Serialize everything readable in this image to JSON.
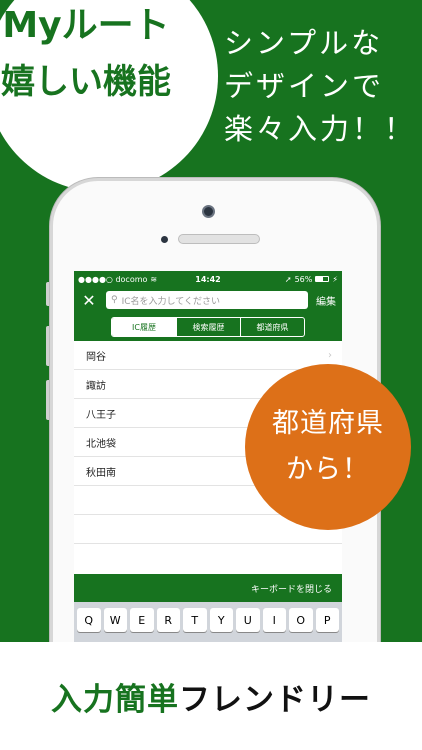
{
  "promo": {
    "circle": {
      "line1": "Myルート",
      "line2": "嬉しい機能"
    },
    "tagline": [
      "シンプルな",
      "デザインで",
      "楽々入力！！"
    ],
    "orange_badge": {
      "line1": "都道府県",
      "line2": "から！"
    },
    "footer": {
      "part1": "入力簡単",
      "part2": "フレンドリー"
    }
  },
  "statusbar": {
    "carrier": "●●●●○ docomo",
    "time": "14:42",
    "battery": "56%",
    "battery_level": 0.56
  },
  "navbar": {
    "search_placeholder": "IC名を入力してください",
    "edit_label": "編集"
  },
  "tabs": [
    {
      "label": "IC履歴"
    },
    {
      "label": "検索履歴"
    },
    {
      "label": "都道府県"
    }
  ],
  "list": {
    "items": [
      {
        "label": "岡谷"
      },
      {
        "label": "諏訪"
      },
      {
        "label": "八王子"
      },
      {
        "label": "北池袋"
      },
      {
        "label": "秋田南"
      }
    ]
  },
  "keyboard": {
    "close_label": "キーボードを閉じる",
    "keys": [
      "Q",
      "W",
      "E",
      "R",
      "T",
      "Y",
      "U",
      "I",
      "O",
      "P"
    ]
  },
  "colors": {
    "brand_green": "#17731f",
    "accent_orange": "#dd7018"
  }
}
